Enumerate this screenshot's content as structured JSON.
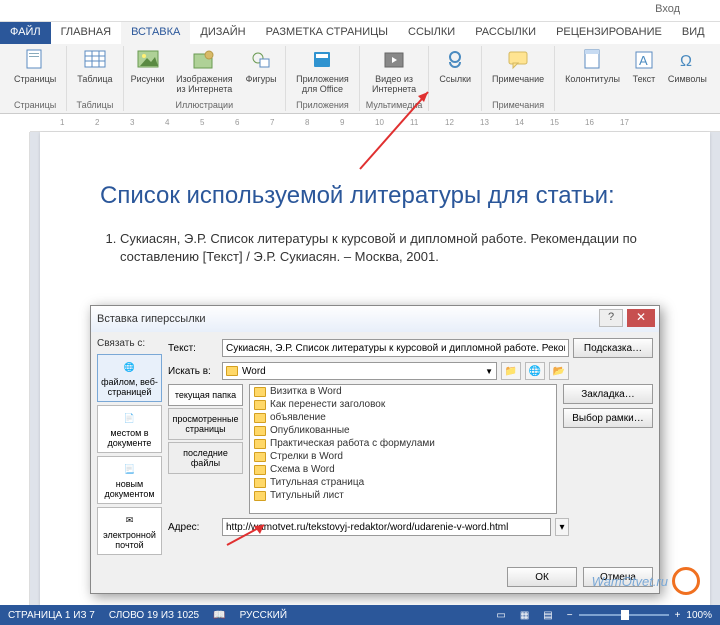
{
  "titlebar": {
    "login": "Вход"
  },
  "tabs": {
    "file": "ФАЙЛ",
    "items": [
      "ГЛАВНАЯ",
      "ВСТАВКА",
      "ДИЗАЙН",
      "РАЗМЕТКА СТРАНИЦЫ",
      "ССЫЛКИ",
      "РАССЫЛКИ",
      "РЕЦЕНЗИРОВАНИЕ",
      "ВИД"
    ],
    "active": 1
  },
  "ribbon": {
    "pages": {
      "label": "Страницы",
      "items": [
        "Страницы"
      ]
    },
    "tables": {
      "label": "Таблицы",
      "items": [
        "Таблица"
      ]
    },
    "illustrations": {
      "label": "Иллюстрации",
      "items": [
        "Рисунки",
        "Изображения из Интернета",
        "Фигуры"
      ]
    },
    "apps": {
      "label": "Приложения",
      "items": [
        "Приложения для Office"
      ]
    },
    "media": {
      "label": "Мультимедиа",
      "items": [
        "Видео из Интернета"
      ]
    },
    "links": {
      "items": [
        "Ссылки"
      ]
    },
    "notes": {
      "label": "Примечания",
      "items": [
        "Примечание"
      ]
    },
    "headers": {
      "label": "",
      "items": [
        "Колонтитулы",
        "Текст",
        "Символы"
      ]
    }
  },
  "ruler": {
    "ticks": [
      "1",
      "2",
      "3",
      "4",
      "5",
      "6",
      "7",
      "8",
      "9",
      "10",
      "11",
      "12",
      "13",
      "14",
      "15",
      "16",
      "17"
    ]
  },
  "document": {
    "heading": "Список используемой литературы для статьи:",
    "item1": "Сукиасян, Э.Р. Список литературы к курсовой и дипломной работе. Рекомендации по составлению [Текст] / Э.Р. Сукиасян. – Москва, 2001."
  },
  "dialog": {
    "title": "Вставка гиперссылки",
    "link_to_label": "Связать с:",
    "link_to": [
      "файлом, веб-страницей",
      "местом в документе",
      "новым документом",
      "электронной почтой"
    ],
    "text_label": "Текст:",
    "text_value": "Сукиасян, Э.Р. Список литературы к курсовой и дипломной работе. Рекомен",
    "hint_btn": "Подсказка…",
    "search_label": "Искать в:",
    "search_value": "Word",
    "browse_tabs": [
      "текущая папка",
      "просмотренные страницы",
      "последние файлы"
    ],
    "files": [
      "Визитка в Word",
      "Как перенести заголовок",
      "объявление",
      "Опубликованные",
      "Практическая работа с формулами",
      "Стрелки в Word",
      "Схема в Word",
      "Титульная страница",
      "Титульный лист"
    ],
    "bookmark_btn": "Закладка…",
    "frame_btn": "Выбор рамки…",
    "address_label": "Адрес:",
    "address_value": "http://wamotvet.ru/tekstovyj-redaktor/word/udarenie-v-word.html",
    "ok": "ОК",
    "cancel": "Отмена"
  },
  "statusbar": {
    "page": "СТРАНИЦА 1 ИЗ 7",
    "words": "СЛОВО 19 ИЗ 1025",
    "lang": "РУССКИЙ",
    "zoom": "100%"
  },
  "watermark": "WamOtvet.ru"
}
